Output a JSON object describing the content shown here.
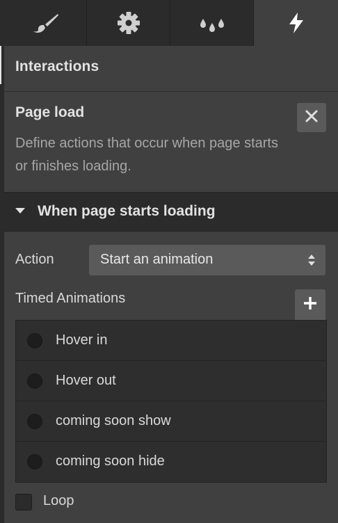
{
  "tabs": [
    {
      "icon": "brush-icon"
    },
    {
      "icon": "gear-icon"
    },
    {
      "icon": "droplets-icon"
    },
    {
      "icon": "lightning-icon",
      "active": true
    }
  ],
  "section_title": "Interactions",
  "page_load": {
    "title": "Page load",
    "description": "Define actions that occur when page starts or finishes loading."
  },
  "trigger": {
    "label": "When page starts loading",
    "expanded": true
  },
  "action": {
    "label": "Action",
    "value": "Start an animation"
  },
  "timed_animations": {
    "label": "Timed Animations",
    "items": [
      {
        "name": "Hover in"
      },
      {
        "name": "Hover out"
      },
      {
        "name": "coming soon show"
      },
      {
        "name": "coming soon hide"
      }
    ]
  },
  "loop": {
    "label": "Loop",
    "checked": false
  },
  "colors": {
    "panel_bg": "#404040",
    "dark_bg": "#2b2b2b",
    "control_bg": "#5a5a5a"
  }
}
